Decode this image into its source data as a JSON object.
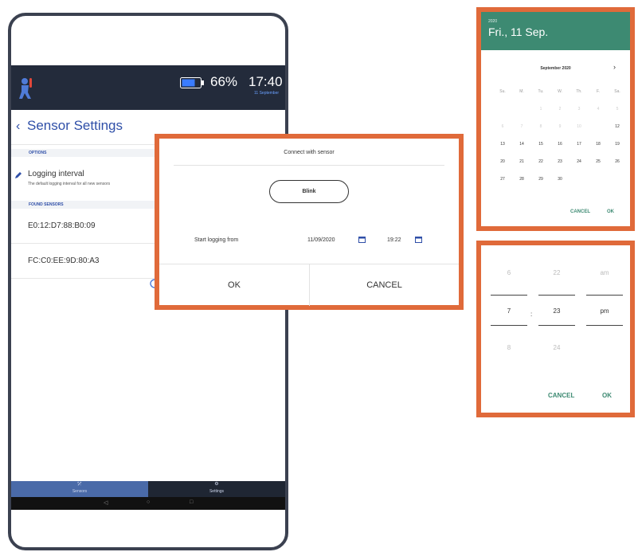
{
  "status_bar": {
    "battery": "66%",
    "time": "17:40",
    "date_sub": "11 September"
  },
  "header": {
    "back_glyph": "‹",
    "title": "Sensor Settings"
  },
  "options": {
    "label": "OPTIONS",
    "logging_title": "Logging interval",
    "logging_sub": "The default logging interval for all new sensors"
  },
  "found": {
    "label": "FOUND SENSORS",
    "sensors": [
      "E0:12:D7:88:B0:09",
      "FC:C0:EE:9D:80:A3"
    ]
  },
  "nav": {
    "sensors_label": "Sensors",
    "settings_label": "Settings",
    "sensors_icon": "⤱",
    "settings_icon": "⚙"
  },
  "android": {
    "back": "◁",
    "home": "○",
    "recent": "□"
  },
  "connect_dialog": {
    "title": "Connect with sensor",
    "blink_label": "Blink",
    "start_label": "Start logging from",
    "date_value": "11/09/2020",
    "time_value": "19:22",
    "ok_label": "OK",
    "cancel_label": "CANCEL"
  },
  "date_picker": {
    "year": "2020",
    "selected_date": "Fri., 11 Sep.",
    "month_label": "September 2020",
    "next_glyph": "›",
    "weekdays": [
      "Su.",
      "M.",
      "Tu.",
      "W.",
      "Th.",
      "F.",
      "Sa."
    ],
    "days": [
      [
        "",
        "",
        "1",
        "2",
        "3",
        "4",
        "5"
      ],
      [
        "6",
        "7",
        "8",
        "9",
        "10",
        "11",
        "12"
      ],
      [
        "13",
        "14",
        "15",
        "16",
        "17",
        "18",
        "19"
      ],
      [
        "20",
        "21",
        "22",
        "23",
        "24",
        "25",
        "26"
      ],
      [
        "27",
        "28",
        "29",
        "30",
        "",
        "",
        ""
      ]
    ],
    "selected_day": "11",
    "cancel_label": "CANCEL",
    "ok_label": "OK"
  },
  "time_picker": {
    "hours": [
      "6",
      "7",
      "8"
    ],
    "minutes": [
      "22",
      "23",
      "24"
    ],
    "ampm": [
      "am",
      "pm"
    ],
    "colon": ":",
    "cancel_label": "CANCEL",
    "ok_label": "OK"
  },
  "colors": {
    "accent": "#3d8a72",
    "callout": "#e06a3a",
    "brand_blue": "#2f4fa8",
    "status_bar": "#232b3b"
  }
}
